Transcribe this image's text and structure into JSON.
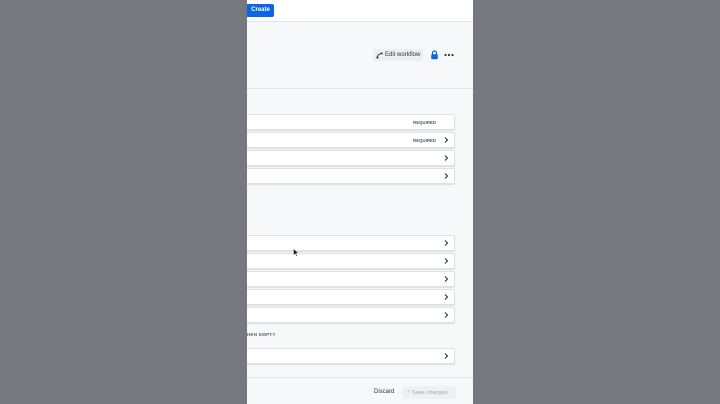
{
  "topbar": {
    "create_label": "Create"
  },
  "toolbar": {
    "edit_workflow_label": "Edit workflow",
    "lock_icon": "lock-icon",
    "more_icon": "more-actions-icon"
  },
  "group1": {
    "rows": [
      {
        "badge": "REQUIRED",
        "has_chevron": false
      },
      {
        "badge": "REQUIRED",
        "has_chevron": true
      },
      {
        "badge": "",
        "has_chevron": true
      },
      {
        "badge": "",
        "has_chevron": true
      }
    ]
  },
  "group2": {
    "rows": [
      {
        "badge": "",
        "has_chevron": true
      },
      {
        "badge": "",
        "has_chevron": true
      },
      {
        "badge": "",
        "has_chevron": true
      },
      {
        "badge": "",
        "has_chevron": true
      },
      {
        "badge": "",
        "has_chevron": true
      }
    ]
  },
  "group3": {
    "label": "HEN EMPTY",
    "rows": [
      {
        "badge": "",
        "has_chevron": true
      }
    ]
  },
  "footer": {
    "discard_label": "Discard",
    "save_label": "Save changes"
  },
  "colors": {
    "accent": "#0c66e4",
    "backdrop": "#75787e",
    "panel": "#f7f8f9"
  }
}
